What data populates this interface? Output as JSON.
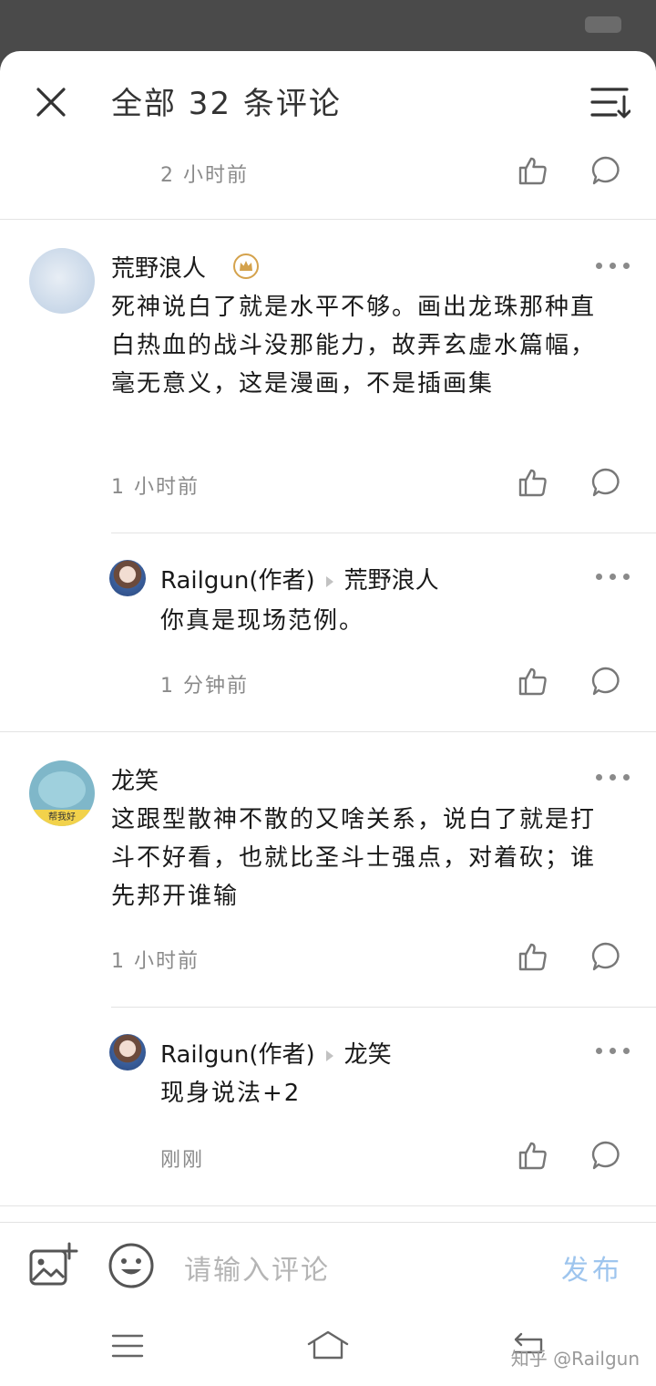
{
  "header": {
    "title": "全部 32 条评论"
  },
  "top_comment": {
    "time": "2 小时前"
  },
  "comments": [
    {
      "author": "荒野浪人",
      "text": "死神说白了就是水平不够。画出龙珠那种直白热血的战斗没那能力，故弄玄虚水篇幅，毫无意义，这是漫画，不是插画集",
      "time": "1 小时前",
      "reply": {
        "author": "Railgun(作者)",
        "to": "荒野浪人",
        "text": "你真是现场范例。",
        "time": "1 分钟前"
      }
    },
    {
      "author": "龙笑",
      "text": "这跟型散神不散的又啥关系，说白了就是打斗不好看，也就比圣斗士强点，对着砍；谁先邦开谁输",
      "time": "1 小时前",
      "avatar_caption": "帮我好",
      "reply": {
        "author": "Railgun(作者)",
        "to": "龙笑",
        "text": "现身说法+2",
        "time": "刚刚"
      }
    }
  ],
  "input": {
    "placeholder": "请输入评论",
    "send_label": "发布"
  },
  "watermark": "知乎 @Railgun",
  "colors": {
    "accent": "#9ec5ee",
    "meta": "#8a8a8a",
    "divider": "#e3e3e3",
    "badge": "#d4a24c"
  }
}
